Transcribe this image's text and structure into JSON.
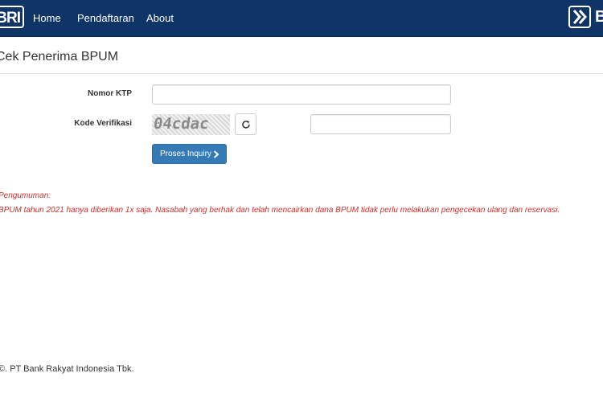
{
  "navbar": {
    "brand_text": "BRI",
    "links": [
      "Home",
      "Pendaftaran",
      "About"
    ],
    "right_brand_text": "B"
  },
  "page": {
    "title": "Cek Penerima BPUM"
  },
  "form": {
    "ktp_label": "Nomor KTP",
    "ktp_value": "",
    "kode_label": "Kode Verifikasi",
    "captcha_text": "04cdac",
    "kode_value": "",
    "submit_label": "Proses Inquiry"
  },
  "announcement": {
    "title": "Pengumuman:",
    "body": "BPUM tahun 2021 hanya diberikan 1x saja. Nasabah yang berhak dan telah mencairkan dana BPUM tidak perlu melakukan pengecekan ulang dan reservasi."
  },
  "footer": {
    "text": "©. PT Bank Rakyat Indonesia Tbk."
  },
  "colors": {
    "navbar_bg": "#0f3466",
    "primary_button": "#337ab7",
    "announcement_text": "#c9302c"
  },
  "icons": {
    "refresh": "refresh-icon",
    "chevron": "chevron-right-icon",
    "logo": "bri-logo-icon"
  }
}
